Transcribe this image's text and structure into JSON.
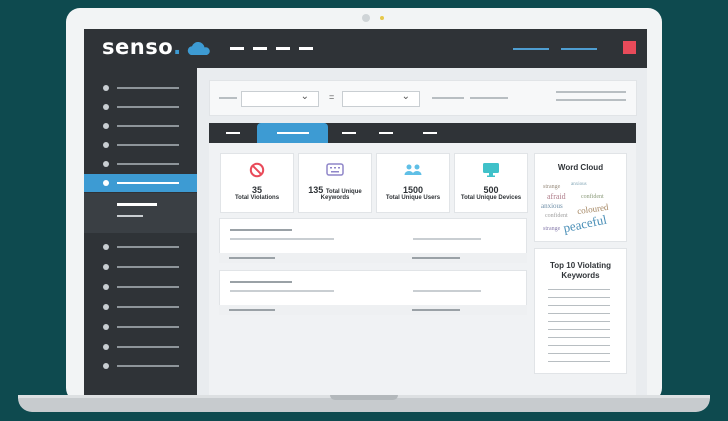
{
  "app": {
    "logo_text": "senso",
    "logo_dot": ".",
    "brand_color": "#3d9bd3",
    "accent_red": "#e94b5a"
  },
  "stats": [
    {
      "icon": "prohibited-icon",
      "value": "35",
      "label": "Total Violations",
      "inline_label": ""
    },
    {
      "icon": "keyboard-icon",
      "value": "135",
      "inline_label": "Total Unique",
      "label": "Keywords"
    },
    {
      "icon": "users-icon",
      "value": "1500",
      "label": "Total Unique Users",
      "inline_label": ""
    },
    {
      "icon": "monitor-icon",
      "value": "500",
      "label": "Total Unique Devices",
      "inline_label": ""
    }
  ],
  "word_cloud": {
    "title": "Word Cloud",
    "words": [
      "peaceful",
      "coloured",
      "afraid",
      "confident",
      "strange",
      "anxious"
    ]
  },
  "top_keywords": {
    "title_line1": "Top 10 Violating",
    "title_line2": "Keywords"
  },
  "filters": {
    "separator": "="
  }
}
